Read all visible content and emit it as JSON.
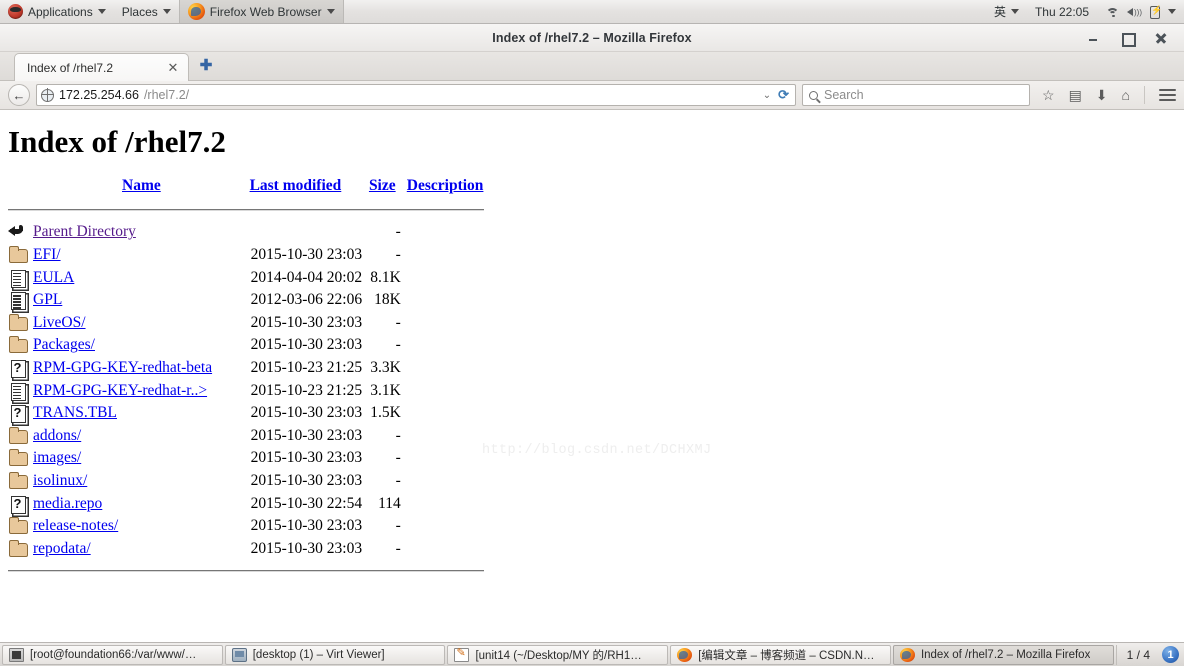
{
  "desktop_panel": {
    "applications_label": "Applications",
    "places_label": "Places",
    "app_menu_label": "Firefox Web Browser",
    "input_method": "英",
    "clock": "Thu 22:05",
    "icons": [
      "redhat-logo",
      "firefox-icon",
      "wifi-icon",
      "volume-muted-icon",
      "battery-icon"
    ]
  },
  "browser": {
    "window_title": "Index of /rhel7.2 – Mozilla Firefox",
    "window_controls": {
      "minimize": "minimize-button",
      "maximize": "maximize-button",
      "close": "close-button"
    },
    "tabs": [
      {
        "label": "Index of /rhel7.2",
        "close_label": "✕"
      }
    ],
    "new_tab_label": "✚",
    "back_label": "←",
    "url": {
      "host": "172.25.254.66",
      "path": "/rhel7.2/",
      "dropdown_label": "⌄",
      "reload_label": "⟳"
    },
    "search": {
      "placeholder": "Search"
    },
    "toolbar_icons": [
      "bookmark-star-icon",
      "reader-list-icon",
      "downloads-icon",
      "home-icon",
      "menu-hamburger-icon"
    ]
  },
  "page": {
    "heading": "Index of /rhel7.2",
    "watermark": "http://blog.csdn.net/DCHXMJ",
    "columns": {
      "name": "Name",
      "last_modified": "Last modified",
      "size": "Size",
      "description": "Description"
    },
    "rows": [
      {
        "icon": "back-arrow-icon",
        "name": "Parent Directory",
        "visited": true,
        "date": "",
        "size": "-",
        "desc": ""
      },
      {
        "icon": "folder-icon",
        "name": "EFI/",
        "visited": false,
        "date": "2015-10-30 23:03",
        "size": "-",
        "desc": ""
      },
      {
        "icon": "document-icon",
        "name": "EULA",
        "visited": false,
        "date": "2014-04-04 20:02",
        "size": "8.1K",
        "desc": ""
      },
      {
        "icon": "document-icon",
        "name": "GPL",
        "visited": false,
        "date": "2012-03-06 22:06",
        "size": "18K",
        "desc": ""
      },
      {
        "icon": "folder-icon",
        "name": "LiveOS/",
        "visited": false,
        "date": "2015-10-30 23:03",
        "size": "-",
        "desc": ""
      },
      {
        "icon": "folder-icon",
        "name": "Packages/",
        "visited": false,
        "date": "2015-10-30 23:03",
        "size": "-",
        "desc": ""
      },
      {
        "icon": "unknown-file-icon",
        "name": "RPM-GPG-KEY-redhat-beta",
        "visited": false,
        "date": "2015-10-23 21:25",
        "size": "3.3K",
        "desc": ""
      },
      {
        "icon": "document-icon",
        "name": "RPM-GPG-KEY-redhat-r..>",
        "visited": false,
        "date": "2015-10-23 21:25",
        "size": "3.1K",
        "desc": ""
      },
      {
        "icon": "unknown-file-icon",
        "name": "TRANS.TBL",
        "visited": false,
        "date": "2015-10-30 23:03",
        "size": "1.5K",
        "desc": ""
      },
      {
        "icon": "folder-icon",
        "name": "addons/",
        "visited": false,
        "date": "2015-10-30 23:03",
        "size": "-",
        "desc": ""
      },
      {
        "icon": "folder-icon",
        "name": "images/",
        "visited": false,
        "date": "2015-10-30 23:03",
        "size": "-",
        "desc": ""
      },
      {
        "icon": "folder-icon",
        "name": "isolinux/",
        "visited": false,
        "date": "2015-10-30 23:03",
        "size": "-",
        "desc": ""
      },
      {
        "icon": "unknown-file-icon",
        "name": "media.repo",
        "visited": false,
        "date": "2015-10-30 22:54",
        "size": "114",
        "desc": ""
      },
      {
        "icon": "folder-icon",
        "name": "release-notes/",
        "visited": false,
        "date": "2015-10-30 23:03",
        "size": "-",
        "desc": ""
      },
      {
        "icon": "folder-icon",
        "name": "repodata/",
        "visited": false,
        "date": "2015-10-30 23:03",
        "size": "-",
        "desc": ""
      }
    ]
  },
  "taskbar": {
    "items": [
      {
        "icon": "terminal-icon",
        "label": "[root@foundation66:/var/www/…",
        "current": false
      },
      {
        "icon": "monitor-icon",
        "label": "[desktop (1) – Virt Viewer]",
        "current": false
      },
      {
        "icon": "text-editor-icon",
        "label": "[unit14 (~/Desktop/MY 的/RH1…",
        "current": false
      },
      {
        "icon": "firefox-icon",
        "label": "[编辑文章 – 博客频道 – CSDN.N…",
        "current": false
      },
      {
        "icon": "firefox-icon",
        "label": "Index of /rhel7.2 – Mozilla Firefox",
        "current": true
      }
    ],
    "workspace_indicator": "1 / 4",
    "workspace_badge": "1"
  },
  "colors": {
    "link": "#0000ee",
    "visited_link": "#551a8b",
    "panel_bg": "#e4e2e0",
    "page_bg": "#ffffff",
    "folder": "#e8c89b"
  }
}
